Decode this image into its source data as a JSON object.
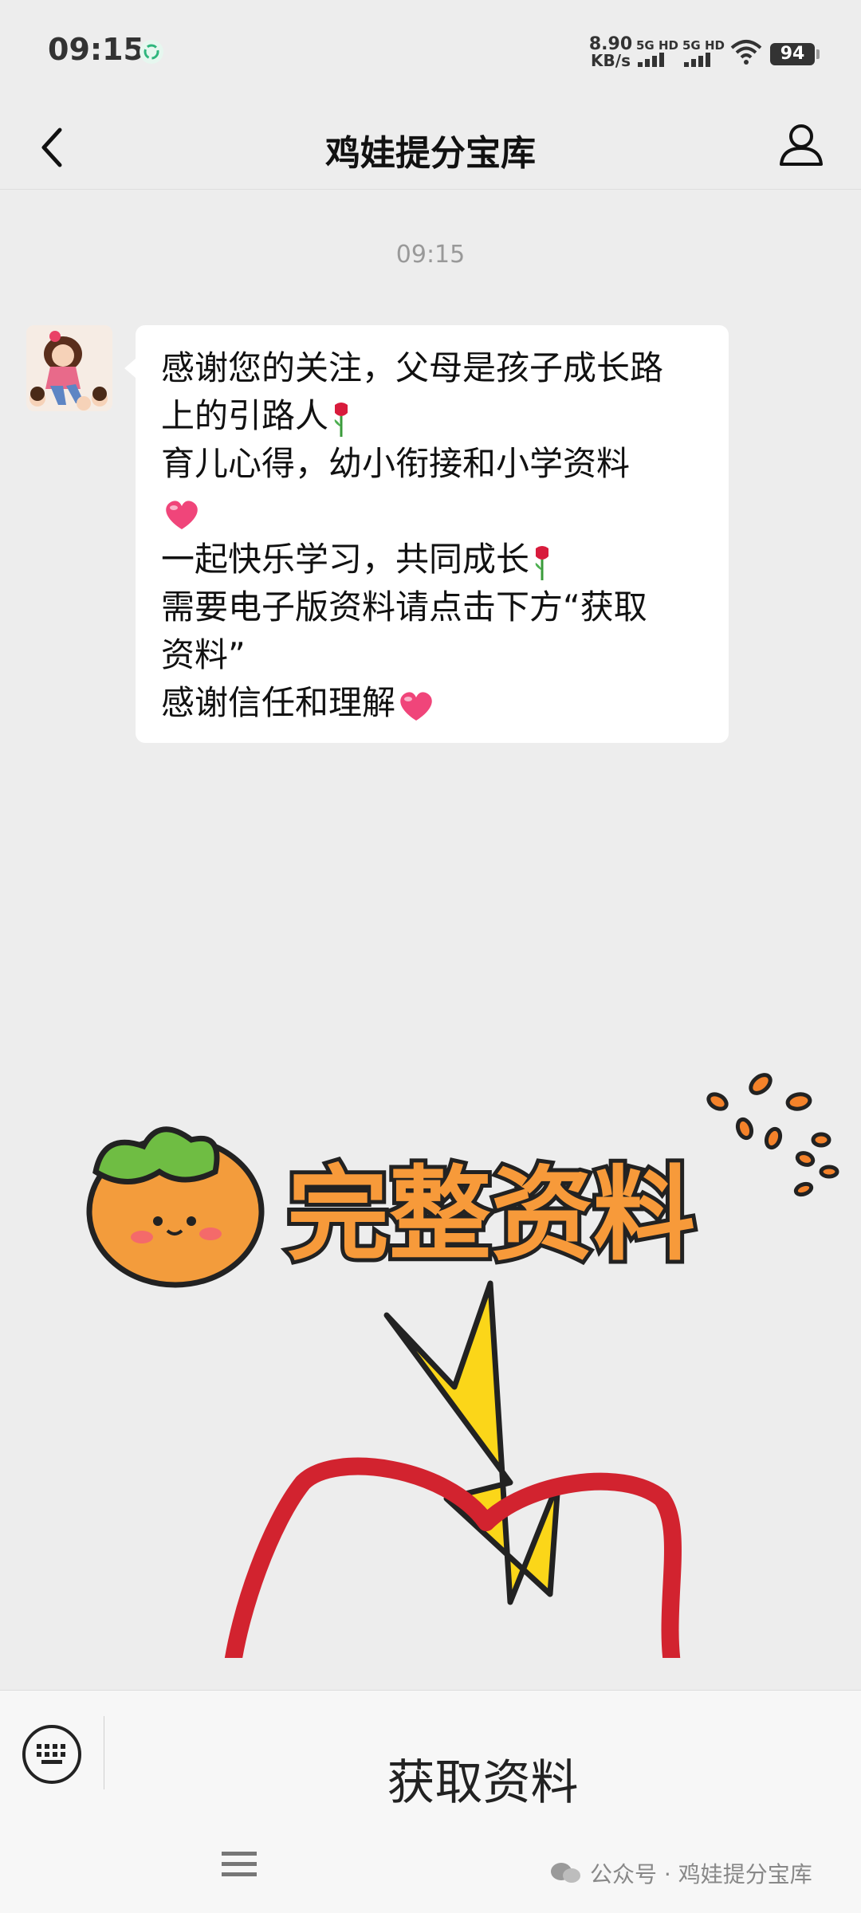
{
  "status_bar": {
    "time": "09:15",
    "net_speed_value": "8.90",
    "net_speed_unit": "KB/s",
    "sim1": "5G HD",
    "sim2": "5G HD",
    "battery": "94"
  },
  "header": {
    "title": "鸡娃提分宝库",
    "back_icon": "chevron-left-icon",
    "profile_icon": "person-icon"
  },
  "chat": {
    "timestamp": "09:15",
    "message": {
      "line1": "感谢您的关注，父母是孩子成长路",
      "line2": "上的引路人",
      "line3": "育儿心得，幼小衔接和小学资料",
      "line5": "一起快乐学习，共同成长",
      "line6": "需要电子版资料请点击下方“获取",
      "line7": "资料”",
      "line8": "感谢信任和理解"
    }
  },
  "sticker": {
    "text": "完整资料"
  },
  "menu_bar": {
    "keyboard_icon": "keyboard-icon",
    "item_label": "获取资料",
    "menu_icon": "hamburger-icon"
  },
  "watermark": {
    "text": "公众号 · 鸡娃提分宝库"
  },
  "colors": {
    "background": "#ededed",
    "bubble": "#ffffff",
    "circle_red": "#d2232f",
    "arrow_yellow": "#fbd619",
    "sticker_orange": "#f79a3a"
  }
}
